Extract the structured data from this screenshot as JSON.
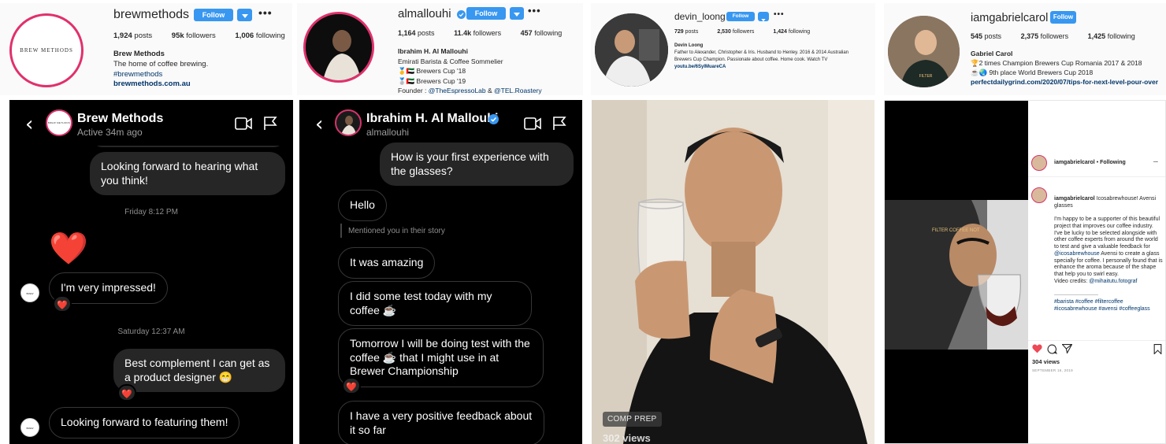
{
  "profiles": [
    {
      "username": "brewmethods",
      "avatar_text": "BREW METHODS",
      "follow_label": "Follow",
      "posts": "1,924",
      "posts_label": "posts",
      "followers": "95k",
      "followers_label": "followers",
      "following": "1,006",
      "following_label": "following",
      "name": "Brew Methods",
      "bio": [
        "The home of coffee brewing."
      ],
      "hashtag": "#brewmethods",
      "link": "brewmethods.com.au"
    },
    {
      "username": "almallouhi",
      "follow_label": "Follow",
      "posts": "1,164",
      "posts_label": "posts",
      "followers": "11.4k",
      "followers_label": "followers",
      "following": "457",
      "following_label": "following",
      "name": "Ibrahim H. Al Mallouhi",
      "bio": [
        "Emirati Barista & Coffee Sommelier",
        "🥇🇦🇪 Brewers Cup '18",
        "🥈🇦🇪 Brewers Cup '19"
      ],
      "founder_prefix": "Founder : ",
      "founder_link1": "@TheEspressoLab",
      "founder_amp": " & ",
      "founder_link2": "@TEL.Roastery"
    },
    {
      "username": "devin_loong",
      "follow_label": "Follow",
      "posts": "729",
      "posts_label": "posts",
      "followers": "2,530",
      "followers_label": "followers",
      "following": "1,424",
      "following_label": "following",
      "name": "Devin Loong",
      "bio": [
        "Father to Alexander, Christopher & Iris. Husband to Henley. 2016 & 2014 Australian",
        "Brewers Cup Champion. Passionate about coffee. Home cook. Watch TV"
      ],
      "link": "youtu.be/6SylMuareCA"
    },
    {
      "username": "iamgabrielcarol",
      "follow_label": "Follow",
      "posts": "545",
      "posts_label": "posts",
      "followers": "2,375",
      "followers_label": "followers",
      "following": "1,425",
      "following_label": "following",
      "name": "Gabriel Carol",
      "bio": [
        "🏆2 times Champion Brewers Cup Romania 2017 & 2018",
        "☕🌏 9th place World Brewers Cup 2018"
      ],
      "link": "perfectdailygrind.com/2020/07/tips-for-next-level-pour-over"
    }
  ],
  "dm1": {
    "name": "Brew Methods",
    "status": "Active 34m ago",
    "avatar_text": "BREW METHODS",
    "messages": {
      "m1": "Looking forward to hearing what you think!",
      "ts1": "Friday 8:12 PM",
      "heart": "❤️",
      "m2": "I'm very impressed!",
      "ts2": "Saturday 12:37 AM",
      "m3": "Best complement I can get as a product designer 😁",
      "m4": "Looking forward to featuring them!"
    },
    "reaction": "❤️"
  },
  "dm2": {
    "name": "Ibrahim H. Al Mallouhi",
    "username": "almallouhi",
    "messages": {
      "m1": "How is your first experience with the glasses?",
      "m2": "Hello",
      "note": "Mentioned you in their story",
      "m3": "It was amazing",
      "m4": "I did some test today with my coffee ☕",
      "m5": "Tomorrow I will be doing test with the coffee ☕ that I might use in at Brewer Championship",
      "m6": "I have a very positive feedback about it so far"
    },
    "reaction": "❤️"
  },
  "video": {
    "badge": "COMP PREP",
    "views": "302 views"
  },
  "post": {
    "username": "iamgabrielcarol",
    "separator": " • ",
    "following": "Following",
    "more": "...",
    "cap_head": "Icosabrewhouse! Avensi glasses",
    "cap_body": "I'm happy to be a supporter of this beautiful project that improves our coffee industry.\nI've be lucky to be selected alongside with other coffee experts from around the world to test and give a valuable feedback for ",
    "cap_mention1": "@icosabrewhouse",
    "cap_body2": " Avensi to create a glass specially for coffee. I personally found that is enhance the aroma because of the shape that help you to swirl easy.\nVideo credits: ",
    "cap_mention2": "@mihaitutu.fotograf",
    "cap_line": "————————",
    "hashtags": "#barista #coffee #filtercoffee #icosabrewhouse #avensi #coffeeglass",
    "views": "304 views",
    "date": "SEPTEMBER 16, 2019",
    "glass_text": "FILTER COFFEE NOT"
  },
  "colors": {
    "follow_blue": "#3897f0",
    "link_blue": "#003569",
    "heart_red": "#ed4956",
    "dm_bg": "#000000"
  }
}
